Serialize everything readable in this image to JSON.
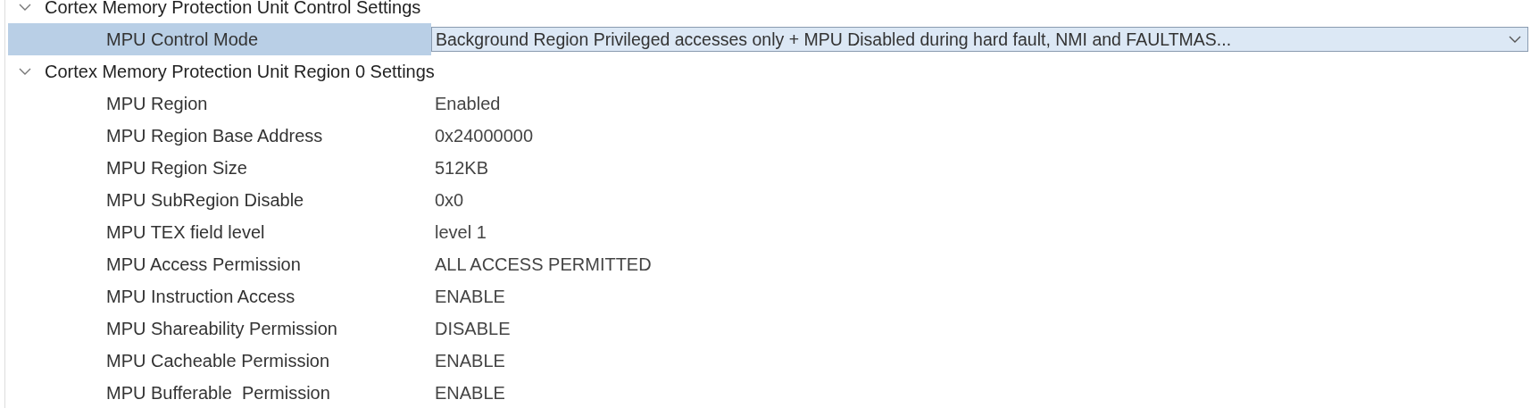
{
  "sections": [
    {
      "title": "Cortex Memory Protection Unit Control Settings",
      "expanded": true,
      "rows": [
        {
          "label": "MPU Control Mode",
          "value": "Background Region Privileged accesses only + MPU Disabled during hard fault, NMI and FAULTMAS...",
          "kind": "dropdown",
          "selected": true
        }
      ]
    },
    {
      "title": "Cortex Memory Protection Unit Region 0 Settings",
      "expanded": true,
      "rows": [
        {
          "label": "MPU Region",
          "value": "Enabled",
          "kind": "text",
          "selected": false
        },
        {
          "label": "MPU Region Base Address",
          "value": "0x24000000",
          "kind": "text",
          "selected": false
        },
        {
          "label": "MPU Region Size",
          "value": "512KB",
          "kind": "text",
          "selected": false
        },
        {
          "label": "MPU SubRegion Disable",
          "value": "0x0",
          "kind": "text",
          "selected": false
        },
        {
          "label": "MPU TEX field level",
          "value": "level 1",
          "kind": "text",
          "selected": false
        },
        {
          "label": "MPU Access Permission",
          "value": "ALL ACCESS PERMITTED",
          "kind": "text",
          "selected": false
        },
        {
          "label": "MPU Instruction Access",
          "value": "ENABLE",
          "kind": "text",
          "selected": false
        },
        {
          "label": "MPU Shareability Permission",
          "value": "DISABLE",
          "kind": "text",
          "selected": false
        },
        {
          "label": "MPU Cacheable Permission",
          "value": "ENABLE",
          "kind": "text",
          "selected": false
        },
        {
          "label": "MPU Bufferable  Permission",
          "value": "ENABLE",
          "kind": "text",
          "selected": false
        }
      ]
    }
  ]
}
